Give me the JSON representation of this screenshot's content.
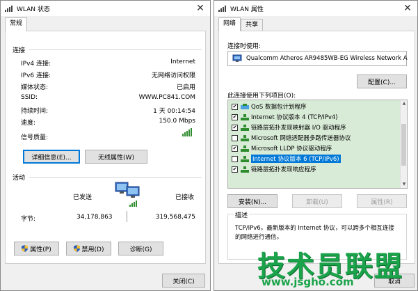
{
  "left_window": {
    "title": "WLAN 状态",
    "tab": "常规",
    "connection_section": "连接",
    "rows": [
      {
        "label": "IPv4 连接:",
        "value": "Internet"
      },
      {
        "label": "IPv6 连接:",
        "value": "无网络访问权限"
      },
      {
        "label": "媒体状态:",
        "value": "已启用"
      },
      {
        "label": "SSID:",
        "value": "WWW.PC841.COM"
      },
      {
        "label": "持续时间:",
        "value": "1 天 00:14:54"
      },
      {
        "label": "速度:",
        "value": "150.0 Mbps"
      },
      {
        "label": "信号质量:",
        "value": ""
      }
    ],
    "details_button": "详细信息(E)...",
    "wireless_props_button": "无线属性(W)",
    "activity_section": "活动",
    "sent_label": "已发送",
    "received_label": "已接收",
    "bytes_label": "字节:",
    "bytes_sent": "34,178,863",
    "bytes_received": "319,568,475",
    "properties_button": "属性(P)",
    "disable_button": "禁用(D)",
    "diagnose_button": "诊断(G)",
    "close_button": "关闭(C)"
  },
  "right_window": {
    "title": "WLAN 属性",
    "tabs": [
      "网络",
      "共享"
    ],
    "connect_using_label": "连接时使用:",
    "adapter_name": "Qualcomm Atheros AR9485WB-EG Wireless Network A",
    "configure_button": "配置(C)...",
    "items_label": "此连接使用下列项目(O):",
    "items": [
      {
        "label": "QoS 数据包计划程序",
        "checked": true,
        "selected": false
      },
      {
        "label": "Internet 协议版本 4 (TCP/IPv4)",
        "checked": true,
        "selected": false
      },
      {
        "label": "链路层拓扑发现映射器 I/O 驱动程序",
        "checked": true,
        "selected": false
      },
      {
        "label": "Microsoft 网络适配器多路传送器协议",
        "checked": false,
        "selected": false
      },
      {
        "label": "Microsoft LLDP 协议驱动程序",
        "checked": true,
        "selected": false
      },
      {
        "label": "Internet 协议版本 6 (TCP/IPv6)",
        "checked": false,
        "selected": true
      },
      {
        "label": "链路层拓扑发现响应程序",
        "checked": true,
        "selected": false
      }
    ],
    "install_button": "安装(N)...",
    "uninstall_button": "卸载(U)",
    "properties_button": "属性(R)",
    "description_label": "描述",
    "description_text": "TCP/IPv6。最新版本的 Internet 协议，可以跨多个相互连接的网络进行通信。",
    "cancel_button": "取消"
  },
  "watermark": {
    "brand": "技术员联盟",
    "url": "www.jsgho.com"
  },
  "colors": {
    "list_highlight": "#d8ebd7",
    "selection": "#0078d7",
    "signal_green": "#2e8b2e",
    "watermark_green": "#1aa34a"
  }
}
